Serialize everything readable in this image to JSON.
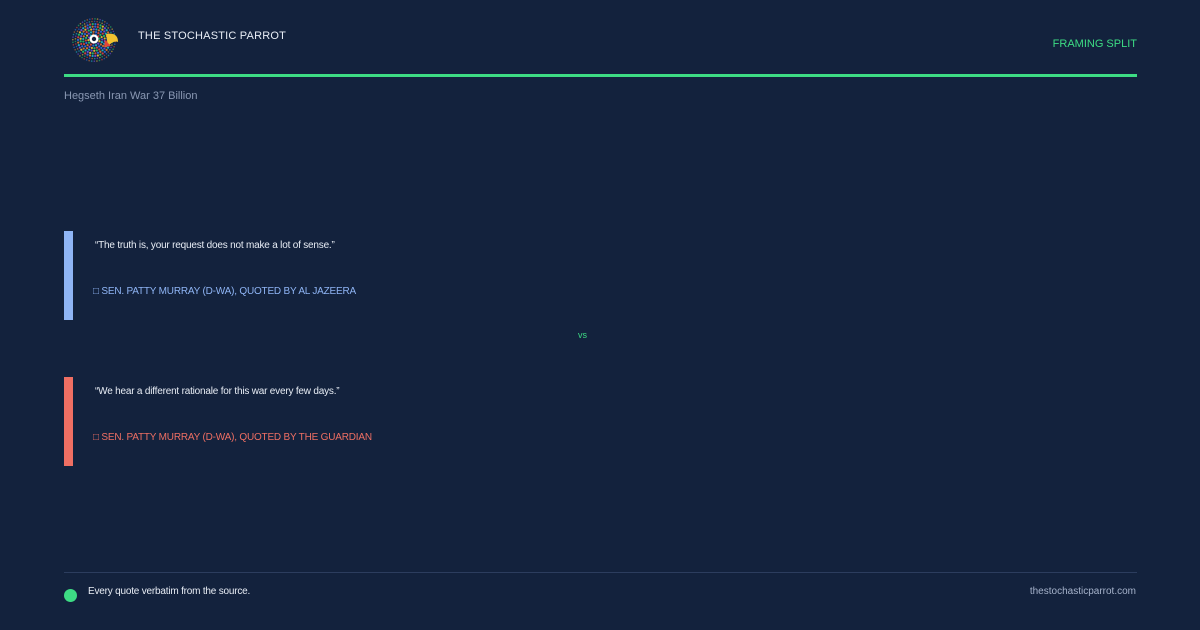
{
  "header": {
    "brand": "THE STOCHASTIC PARROT",
    "tag": "FRAMING SPLIT",
    "logo_icon": "parrot-logo-icon"
  },
  "subtitle": "Hegseth Iran War 37 Billion",
  "quotes": [
    {
      "text": "“The truth is, your request does not make a lot of sense.”",
      "attribution": "□ SEN. PATTY MURRAY (D-WA), QUOTED BY AL JAZEERA",
      "accent_color": "#8fb5f5"
    },
    {
      "text": "“We hear a different rationale for this war every few days.”",
      "attribution": "□ SEN. PATTY MURRAY (D-WA), QUOTED BY THE GUARDIAN",
      "accent_color": "#ef6f63"
    }
  ],
  "separator": "vs",
  "footer": {
    "note": "Every quote verbatim from the source.",
    "url": "thestochasticparrot.com",
    "dot_icon": "green-dot-icon"
  },
  "colors": {
    "background": "#13223d",
    "accent": "#3ddc84",
    "quote_blue": "#8fb5f5",
    "quote_red": "#ef6f63"
  }
}
